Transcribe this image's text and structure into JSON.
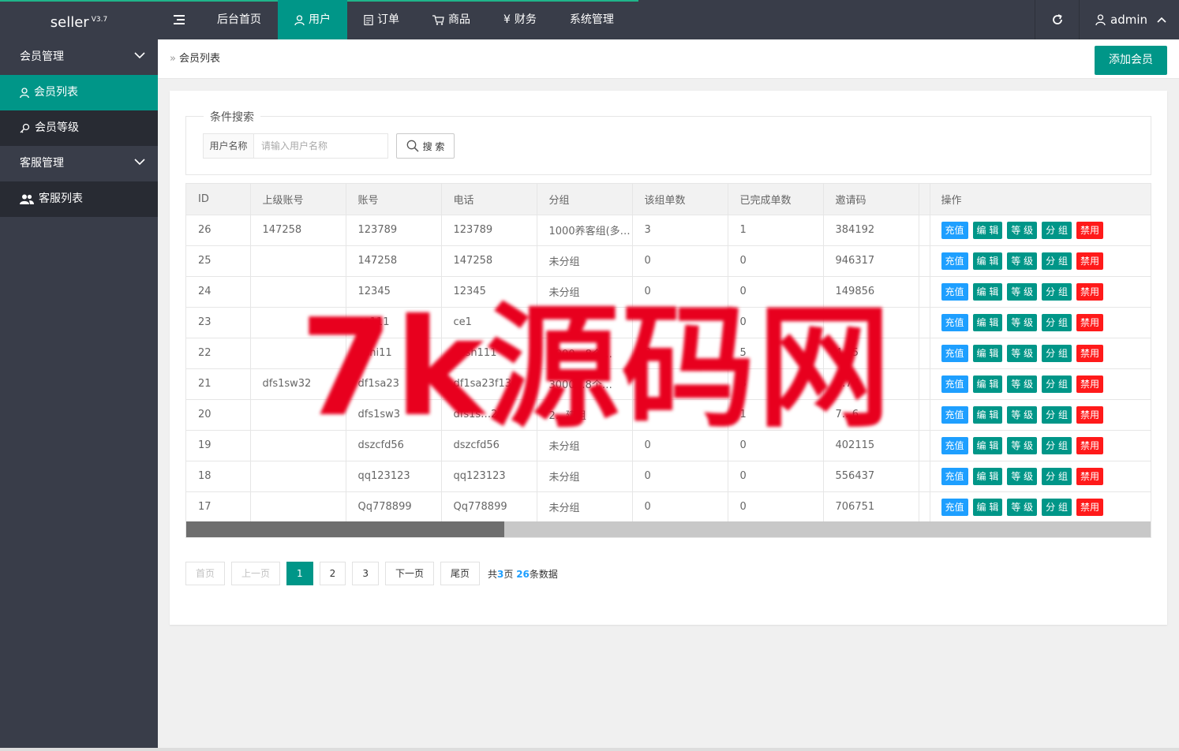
{
  "app": {
    "name": "seller",
    "version": "V3.7"
  },
  "topnav": {
    "items": [
      {
        "label": "后台首页",
        "icon": "none"
      },
      {
        "label": "用户",
        "icon": "user-icon",
        "active": true
      },
      {
        "label": "订单",
        "icon": "document-icon"
      },
      {
        "label": "商品",
        "icon": "cart-icon"
      },
      {
        "label": "财务",
        "icon": "yen-icon"
      },
      {
        "label": "系统管理",
        "icon": "none"
      }
    ],
    "user": "admin"
  },
  "sidebar": {
    "groups": [
      {
        "label": "会员管理",
        "items": [
          {
            "label": "会员列表",
            "active": true
          },
          {
            "label": "会员等级"
          }
        ]
      },
      {
        "label": "客服管理",
        "items": [
          {
            "label": "客服列表"
          }
        ]
      }
    ]
  },
  "breadcrumb": {
    "current": "会员列表"
  },
  "add_button": "添加会员",
  "search": {
    "legend": "条件搜索",
    "label": "用户名称",
    "placeholder": "请输入用户名称",
    "button": "搜 索"
  },
  "table": {
    "headers": [
      "ID",
      "上级账号",
      "账号",
      "电话",
      "分组",
      "该组单数",
      "已完成单数",
      "邀请码",
      "操作"
    ],
    "actions": [
      "充值",
      "编 辑",
      "等 级",
      "分 组",
      "禁用"
    ],
    "rows": [
      [
        "26",
        "147258",
        "123789",
        "123789",
        "1000养客组(多…",
        "3",
        "1",
        "384192"
      ],
      [
        "25",
        "",
        "147258",
        "147258",
        "未分组",
        "0",
        "0",
        "946317"
      ],
      [
        "24",
        "",
        "12345",
        "12345",
        "未分组",
        "0",
        "0",
        "149856"
      ],
      [
        "23",
        "",
        "ce111",
        "ce1",
        "",
        "",
        "0",
        ""
      ],
      [
        "22",
        "",
        "eshi11",
        "cesh111",
        "3000…8个…",
        "8",
        "5",
        "4…5"
      ],
      [
        "21",
        "dfs1sw32",
        "df1sa23",
        "df1sa23f13",
        "3000…8个…",
        "",
        "3",
        "…77"
      ],
      [
        "20",
        "",
        "dfs1sw3",
        "dfs1s…2",
        "2…建组",
        "",
        "1",
        "7…6"
      ],
      [
        "19",
        "",
        "dszcfd56",
        "dszcfd56",
        "未分组",
        "0",
        "0",
        "402115"
      ],
      [
        "18",
        "",
        "qq123123",
        "qq123123",
        "未分组",
        "0",
        "0",
        "556437"
      ],
      [
        "17",
        "",
        "Qq778899",
        "Qq778899",
        "未分组",
        "0",
        "0",
        "706751"
      ]
    ]
  },
  "pagination": {
    "first": "首页",
    "prev": "上一页",
    "pages": [
      "1",
      "2",
      "3"
    ],
    "current": "1",
    "next": "下一页",
    "last": "尾页",
    "info_prefix": "共",
    "total_pages": "3",
    "info_mid": "页",
    "total_records": "26",
    "info_suffix": "条数据"
  },
  "watermark": "7k源码网",
  "colors": {
    "primary": "#009688",
    "header": "#393d49",
    "charge": "#1e9fff",
    "ban": "#ff1a1a",
    "watermark": "#e8001e"
  }
}
